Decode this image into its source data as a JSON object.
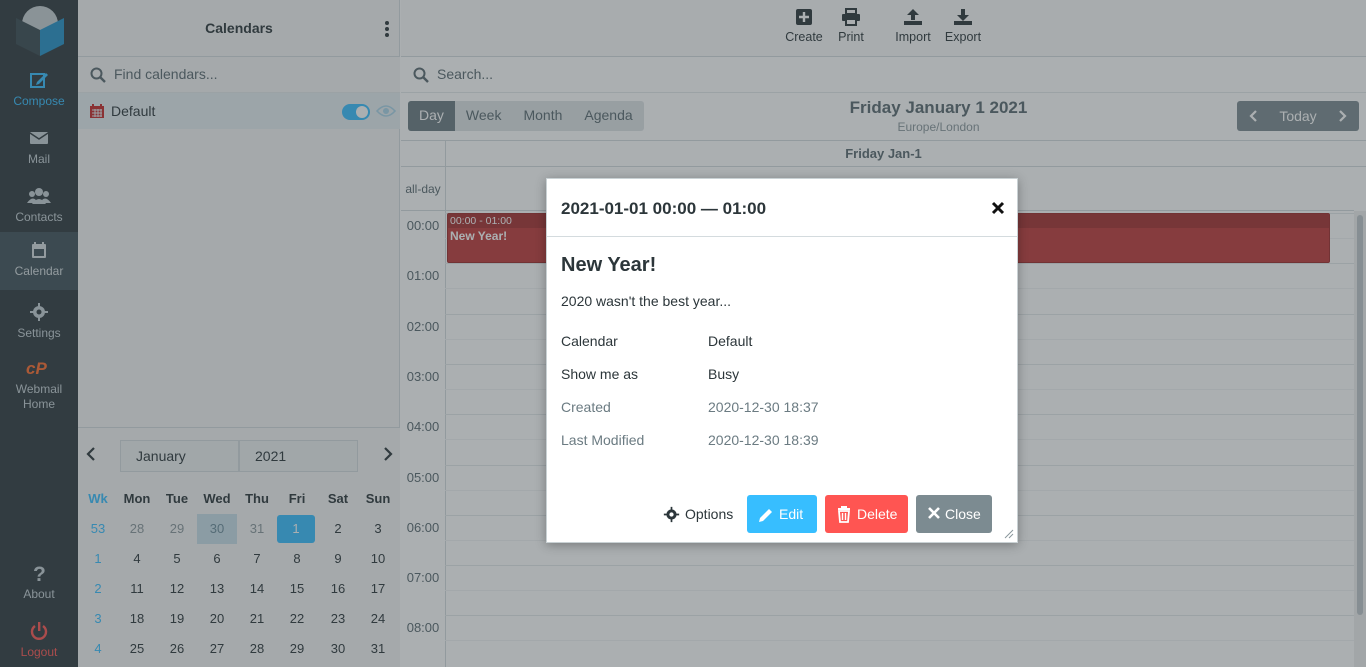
{
  "nav": {
    "items": [
      {
        "label": "Compose",
        "icon": "compose-icon"
      },
      {
        "label": "Mail",
        "icon": "envelope-icon"
      },
      {
        "label": "Contacts",
        "icon": "users-icon"
      },
      {
        "label": "Calendar",
        "icon": "calendar-icon"
      },
      {
        "label": "Settings",
        "icon": "gear-icon"
      },
      {
        "label": "Webmail Home",
        "icon": "cpanel-icon"
      }
    ],
    "about": "About",
    "logout": "Logout"
  },
  "sidebar": {
    "title": "Calendars",
    "search_placeholder": "Find calendars...",
    "calendars": [
      {
        "name": "Default",
        "enabled": true
      }
    ]
  },
  "minical": {
    "month": "January",
    "year": "2021",
    "headers": [
      "Wk",
      "Mon",
      "Tue",
      "Wed",
      "Thu",
      "Fri",
      "Sat",
      "Sun"
    ],
    "weeks": [
      [
        "53",
        "28",
        "29",
        "30",
        "31",
        "1",
        "2",
        "3"
      ],
      [
        "1",
        "4",
        "5",
        "6",
        "7",
        "8",
        "9",
        "10"
      ],
      [
        "2",
        "11",
        "12",
        "13",
        "14",
        "15",
        "16",
        "17"
      ],
      [
        "3",
        "18",
        "19",
        "20",
        "21",
        "22",
        "23",
        "24"
      ],
      [
        "4",
        "25",
        "26",
        "27",
        "28",
        "29",
        "30",
        "31"
      ]
    ]
  },
  "toolbar": {
    "create": "Create",
    "print": "Print",
    "import": "Import",
    "export": "Export"
  },
  "main": {
    "search_placeholder": "Search...",
    "views": [
      "Day",
      "Week",
      "Month",
      "Agenda"
    ],
    "active_view": "Day",
    "date_title": "Friday January 1 2021",
    "timezone": "Europe/London",
    "today": "Today",
    "day_header": "Friday Jan-1",
    "allday": "all-day",
    "hours": [
      "00:00",
      "01:00",
      "02:00",
      "03:00",
      "04:00",
      "05:00",
      "06:00",
      "07:00",
      "08:00"
    ]
  },
  "event": {
    "time": "00:00 - 01:00",
    "title": "New Year!",
    "color": "#bf3a3a"
  },
  "dialog": {
    "header": "2021-01-01 00:00 — 01:00",
    "title": "New Year!",
    "description": "2020 wasn't the best year...",
    "props": [
      {
        "k": "Calendar",
        "v": "Default"
      },
      {
        "k": "Show me as",
        "v": "Busy"
      },
      {
        "k": "Created",
        "v": "2020-12-30 18:37"
      },
      {
        "k": "Last Modified",
        "v": "2020-12-30 18:39"
      }
    ],
    "buttons": {
      "options": "Options",
      "edit": "Edit",
      "delete": "Delete",
      "close": "Close"
    }
  },
  "colors": {
    "accent": "#37beff",
    "danger": "#ff5552",
    "nav_bg": "#2f3a3f"
  }
}
